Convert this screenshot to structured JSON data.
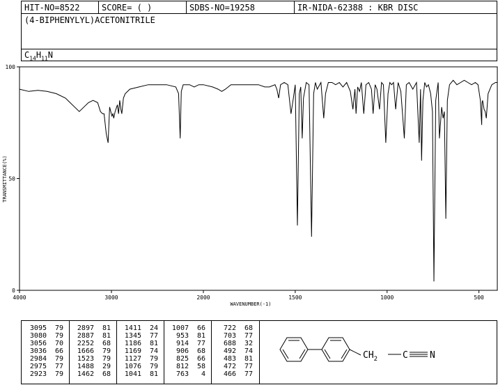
{
  "header": {
    "hit_no": "HIT-NO=8522",
    "score": "SCORE=  (   )",
    "sdbs_no": "SDBS-NO=19258",
    "ir_nida": "IR-NIDA-62388 : KBR DISC"
  },
  "compound": {
    "name": "(4-BIPHENYLYL)ACETONITRILE",
    "formula_parts": [
      "C",
      "14",
      "H",
      "11",
      "N"
    ]
  },
  "chart_data": {
    "type": "line",
    "xlabel": "WAVENUMBER(-1)",
    "ylabel": "TRANSMITTANCE(%)",
    "xlim": [
      4000,
      400
    ],
    "ylim": [
      0,
      100
    ],
    "x_ticks": [
      4000,
      3000,
      2000,
      1500,
      1000,
      500
    ],
    "y_ticks": [
      0,
      50,
      100
    ],
    "grid": false,
    "series": [
      {
        "x": [
          4000,
          3900,
          3800,
          3700,
          3600,
          3500,
          3450,
          3400,
          3350,
          3300,
          3250,
          3200,
          3150,
          3120,
          3096,
          3080,
          3056,
          3036,
          3020,
          2995,
          2984,
          2975,
          2960,
          2935,
          2923,
          2910,
          2897,
          2887,
          2870,
          2850,
          2800,
          2700,
          2600,
          2500,
          2400,
          2300,
          2270,
          2252,
          2240,
          2220,
          2150,
          2100,
          2050,
          2000,
          1950,
          1920,
          1900,
          1880,
          1850,
          1800,
          1750,
          1700,
          1666,
          1640,
          1610,
          1600,
          1590,
          1580,
          1560,
          1540,
          1523,
          1510,
          1500,
          1488,
          1478,
          1470,
          1462,
          1455,
          1440,
          1425,
          1411,
          1400,
          1390,
          1380,
          1360,
          1345,
          1335,
          1320,
          1300,
          1280,
          1260,
          1240,
          1220,
          1200,
          1186,
          1175,
          1169,
          1160,
          1150,
          1140,
          1127,
          1115,
          1100,
          1085,
          1076,
          1065,
          1055,
          1041,
          1030,
          1020,
          1007,
          995,
          985,
          975,
          965,
          953,
          940,
          925,
          914,
          906,
          895,
          880,
          860,
          840,
          825,
          818,
          812,
          805,
          795,
          785,
          775,
          763,
          753,
          745,
          735,
          722,
          715,
          703,
          695,
          688,
          680,
          672,
          660,
          640,
          620,
          600,
          580,
          560,
          540,
          520,
          505,
          492,
          485,
          483,
          480,
          472,
          466,
          460,
          450,
          430,
          410,
          400
        ],
        "y": [
          90,
          89,
          89.5,
          89,
          88,
          86,
          84,
          82,
          80,
          82,
          84,
          85,
          84,
          80,
          79,
          79,
          70,
          66,
          82,
          78,
          79,
          77,
          80,
          83,
          79,
          85,
          81,
          79,
          86,
          88,
          90,
          91,
          92,
          92,
          92,
          91,
          88,
          68,
          89,
          92,
          92,
          91,
          92,
          92,
          91,
          90,
          89,
          90,
          92,
          92,
          92,
          92,
          91,
          91,
          92,
          90,
          86,
          92,
          93,
          92,
          79,
          86,
          92,
          29,
          88,
          91,
          68,
          86,
          93,
          92,
          24,
          88,
          93,
          90,
          93,
          77,
          88,
          93,
          93,
          92,
          93,
          91,
          93,
          89,
          81,
          90,
          79,
          91,
          89,
          93,
          79,
          92,
          93,
          90,
          79,
          92,
          90,
          81,
          93,
          92,
          66,
          88,
          93,
          92,
          93,
          81,
          93,
          89,
          77,
          68,
          92,
          93,
          90,
          93,
          66,
          90,
          58,
          85,
          93,
          91,
          92,
          88,
          80,
          4,
          85,
          93,
          68,
          82,
          77,
          80,
          32,
          85,
          92,
          94,
          92,
          93,
          94,
          93,
          92,
          93,
          92,
          85,
          74,
          84,
          85,
          81,
          80,
          77,
          88,
          92,
          93,
          93
        ]
      }
    ]
  },
  "peak_table": {
    "columns": [
      [
        [
          "3095",
          "79"
        ],
        [
          "3080",
          "79"
        ],
        [
          "3056",
          "70"
        ],
        [
          "3036",
          "66"
        ],
        [
          "2984",
          "79"
        ],
        [
          "2975",
          "77"
        ],
        [
          "2923",
          "79"
        ]
      ],
      [
        [
          "2897",
          "81"
        ],
        [
          "2887",
          "81"
        ],
        [
          "2252",
          "68"
        ],
        [
          "1666",
          "79"
        ],
        [
          "1523",
          "79"
        ],
        [
          "1488",
          "29"
        ],
        [
          "1462",
          "68"
        ]
      ],
      [
        [
          "1411",
          "24"
        ],
        [
          "1345",
          "77"
        ],
        [
          "1186",
          "81"
        ],
        [
          "1169",
          "74"
        ],
        [
          "1127",
          "79"
        ],
        [
          "1076",
          "79"
        ],
        [
          "1041",
          "81"
        ]
      ],
      [
        [
          "1007",
          "66"
        ],
        [
          "953",
          "81"
        ],
        [
          "914",
          "77"
        ],
        [
          "906",
          "68"
        ],
        [
          "825",
          "66"
        ],
        [
          "812",
          "58"
        ],
        [
          "763",
          "4"
        ]
      ],
      [
        [
          "722",
          "68"
        ],
        [
          "703",
          "77"
        ],
        [
          "688",
          "32"
        ],
        [
          "492",
          "74"
        ],
        [
          "483",
          "81"
        ],
        [
          "472",
          "77"
        ],
        [
          "466",
          "77"
        ]
      ]
    ]
  },
  "structure": {
    "ch2_label": "CH",
    "ch2_sub": "2",
    "c_label": "C",
    "n_label": "N"
  }
}
